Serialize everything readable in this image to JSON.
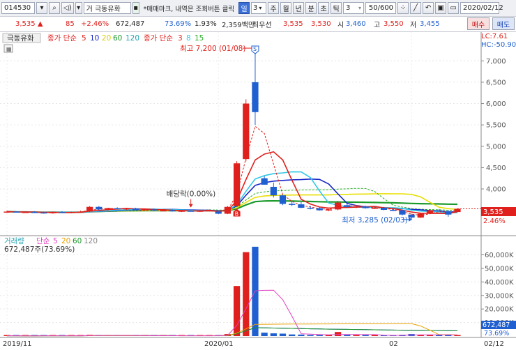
{
  "toolbar": {
    "code": "014530",
    "market_prefix": "거",
    "stock_name": "극동유화",
    "notice": "*매매마크, 내역은 조회버튼 클릭",
    "period_active": "일",
    "period_num": "3",
    "periods": [
      "주",
      "월",
      "년",
      "분",
      "초",
      "틱"
    ],
    "tick_num": "3",
    "count": "50/600",
    "date": "2020/02/12"
  },
  "quote": {
    "price": "3,535",
    "change": "85",
    "change_pct": "+2.46%",
    "volume": "672,487",
    "vol_ratio": "73.69%",
    "turnover": "1.93%",
    "amount": "2,359백만",
    "best_label": "최우선",
    "ask": "3,535",
    "bid": "3,530",
    "open_label": "시",
    "open": "3,460",
    "high_label": "고",
    "high": "3,550",
    "low_label": "저",
    "low": "3,455",
    "buy_label": "매수",
    "sell_label": "매도"
  },
  "price_panel": {
    "name_tag": "극동유화",
    "ma_label": "종가 단순",
    "ma_periods": [
      "5",
      "10",
      "20",
      "60",
      "120"
    ],
    "ma2_label": "종가 단순",
    "ma2_periods": [
      "3",
      "8",
      "15"
    ],
    "lc": "LC:7.61",
    "hc": "HC:-50.90",
    "high_annotation": "최고 7,200 (01/08)",
    "low_annotation": "최저 3,285 (02/03)",
    "dividend_annotation": "배당락(0.00%)",
    "current_price": "3,535",
    "current_pct": "2.46%",
    "mark_s": "S",
    "mark_b": "B"
  },
  "volume_panel": {
    "label": "거래량",
    "ma_label": "단순",
    "ma_periods": [
      "5",
      "20",
      "60",
      "120"
    ],
    "volume_text": "672,487주(73.69%)",
    "current_vol": "672,487",
    "current_pct": "73.69%"
  },
  "x_axis": {
    "labels": [
      "2019/11",
      "2020/01",
      "02",
      "02/12"
    ]
  },
  "colors": {
    "up": "#e0201c",
    "down": "#1f5fd0",
    "ma5": "#e0201c",
    "ma10": "#1a28c8",
    "ma20": "#e8e000",
    "ma60": "#1a9a2a",
    "ma120": "#20a0b0",
    "ma3": "#e0201c",
    "ma8": "#30c8e8",
    "ma15": "#22aa22",
    "vol_ma5": "#e040c0",
    "vol_ma20": "#e8a000",
    "vol_ma60": "#1a9a2a",
    "vol_ma120": "#1a28c8"
  },
  "chart_data": {
    "type": "candlestick",
    "price_axis": {
      "ticks": [
        "7,000",
        "6,500",
        "6,000",
        "5,500",
        "5,000",
        "4,500",
        "4,000"
      ],
      "range": [
        3200,
        7250
      ]
    },
    "volume_axis": {
      "ticks": [
        "60,000K",
        "50,000K",
        "40,000K",
        "30,000K",
        "20,000K",
        "10,000K"
      ],
      "range": [
        0,
        68000
      ]
    },
    "candles": [
      {
        "o": 3460,
        "h": 3490,
        "l": 3440,
        "c": 3470,
        "v": 200
      },
      {
        "o": 3470,
        "h": 3480,
        "l": 3450,
        "c": 3455,
        "v": 180
      },
      {
        "o": 3455,
        "h": 3470,
        "l": 3440,
        "c": 3460,
        "v": 150
      },
      {
        "o": 3460,
        "h": 3480,
        "l": 3440,
        "c": 3450,
        "v": 170
      },
      {
        "o": 3450,
        "h": 3470,
        "l": 3420,
        "c": 3430,
        "v": 300
      },
      {
        "o": 3430,
        "h": 3470,
        "l": 3420,
        "c": 3460,
        "v": 250
      },
      {
        "o": 3460,
        "h": 3480,
        "l": 3440,
        "c": 3445,
        "v": 200
      },
      {
        "o": 3445,
        "h": 3470,
        "l": 3430,
        "c": 3460,
        "v": 180
      },
      {
        "o": 3460,
        "h": 3490,
        "l": 3450,
        "c": 3470,
        "v": 220
      },
      {
        "o": 3470,
        "h": 3600,
        "l": 3460,
        "c": 3580,
        "v": 900
      },
      {
        "o": 3580,
        "h": 3600,
        "l": 3500,
        "c": 3520,
        "v": 600
      },
      {
        "o": 3520,
        "h": 3560,
        "l": 3490,
        "c": 3550,
        "v": 400
      },
      {
        "o": 3550,
        "h": 3570,
        "l": 3520,
        "c": 3530,
        "v": 300
      },
      {
        "o": 3530,
        "h": 3560,
        "l": 3510,
        "c": 3545,
        "v": 250
      },
      {
        "o": 3545,
        "h": 3560,
        "l": 3500,
        "c": 3510,
        "v": 300
      },
      {
        "o": 3510,
        "h": 3530,
        "l": 3490,
        "c": 3520,
        "v": 200
      },
      {
        "o": 3520,
        "h": 3540,
        "l": 3480,
        "c": 3490,
        "v": 250
      },
      {
        "o": 3490,
        "h": 3520,
        "l": 3480,
        "c": 3500,
        "v": 200
      },
      {
        "o": 3500,
        "h": 3520,
        "l": 3470,
        "c": 3480,
        "v": 220
      },
      {
        "o": 3480,
        "h": 3500,
        "l": 3460,
        "c": 3490,
        "v": 180
      },
      {
        "o": 3490,
        "h": 3500,
        "l": 3470,
        "c": 3475,
        "v": 160
      },
      {
        "o": 3475,
        "h": 3500,
        "l": 3460,
        "c": 3490,
        "v": 170
      },
      {
        "o": 3490,
        "h": 3520,
        "l": 3480,
        "c": 3510,
        "v": 200
      },
      {
        "o": 3470,
        "h": 3490,
        "l": 3410,
        "c": 3420,
        "v": 600
      },
      {
        "o": 3420,
        "h": 3600,
        "l": 3410,
        "c": 3580,
        "v": 1500
      },
      {
        "o": 3600,
        "h": 4650,
        "l": 3600,
        "c": 4600,
        "v": 37000
      },
      {
        "o": 4700,
        "h": 6100,
        "l": 4650,
        "c": 6000,
        "v": 62000
      },
      {
        "o": 6500,
        "h": 7200,
        "l": 5500,
        "c": 5800,
        "v": 66000
      },
      {
        "o": 4250,
        "h": 4300,
        "l": 4100,
        "c": 4100,
        "v": 2500
      },
      {
        "o": 4050,
        "h": 4150,
        "l": 3800,
        "c": 3850,
        "v": 2000
      },
      {
        "o": 3850,
        "h": 3860,
        "l": 3620,
        "c": 3650,
        "v": 1800
      },
      {
        "o": 3650,
        "h": 3700,
        "l": 3600,
        "c": 3630,
        "v": 1200
      },
      {
        "o": 3640,
        "h": 3690,
        "l": 3550,
        "c": 3560,
        "v": 1100
      },
      {
        "o": 3560,
        "h": 3600,
        "l": 3520,
        "c": 3550,
        "v": 800
      },
      {
        "o": 3550,
        "h": 3580,
        "l": 3490,
        "c": 3500,
        "v": 700
      },
      {
        "o": 3500,
        "h": 3530,
        "l": 3480,
        "c": 3520,
        "v": 500
      },
      {
        "o": 3520,
        "h": 3720,
        "l": 3500,
        "c": 3680,
        "v": 3000
      },
      {
        "o": 3620,
        "h": 3660,
        "l": 3560,
        "c": 3580,
        "v": 900
      },
      {
        "o": 3580,
        "h": 3620,
        "l": 3550,
        "c": 3590,
        "v": 600
      },
      {
        "o": 3590,
        "h": 3610,
        "l": 3540,
        "c": 3550,
        "v": 500
      },
      {
        "o": 3550,
        "h": 3580,
        "l": 3530,
        "c": 3560,
        "v": 400
      },
      {
        "o": 3560,
        "h": 3580,
        "l": 3500,
        "c": 3510,
        "v": 600
      },
      {
        "o": 3510,
        "h": 3540,
        "l": 3480,
        "c": 3500,
        "v": 500
      },
      {
        "o": 3500,
        "h": 3520,
        "l": 3380,
        "c": 3400,
        "v": 900
      },
      {
        "o": 3400,
        "h": 3420,
        "l": 3285,
        "c": 3330,
        "v": 1500
      },
      {
        "o": 3330,
        "h": 3440,
        "l": 3320,
        "c": 3420,
        "v": 800
      },
      {
        "o": 3430,
        "h": 3520,
        "l": 3420,
        "c": 3500,
        "v": 700
      },
      {
        "o": 3500,
        "h": 3530,
        "l": 3470,
        "c": 3480,
        "v": 500
      },
      {
        "o": 3480,
        "h": 3510,
        "l": 3350,
        "c": 3400,
        "v": 1200
      },
      {
        "o": 3460,
        "h": 3550,
        "l": 3455,
        "c": 3535,
        "v": 672
      }
    ]
  }
}
